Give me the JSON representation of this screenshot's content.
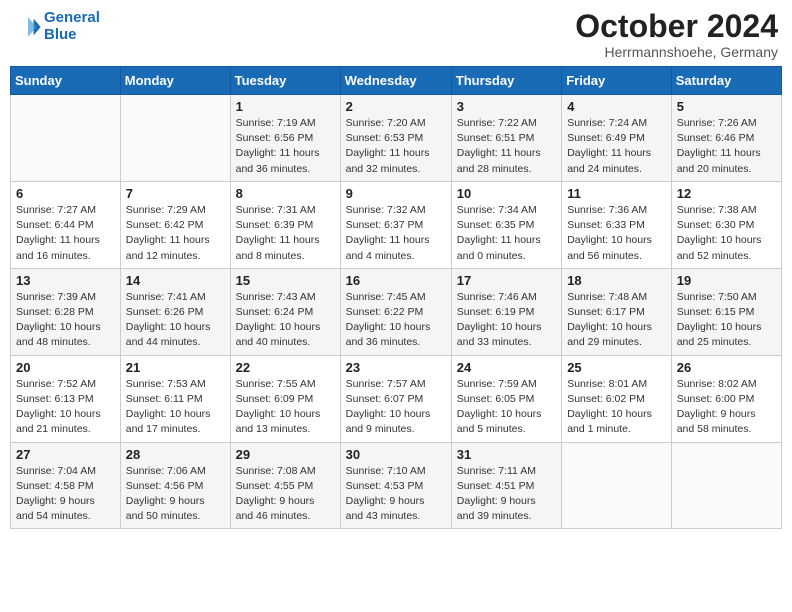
{
  "logo": {
    "line1": "General",
    "line2": "Blue"
  },
  "title": "October 2024",
  "location": "Herrmannshoehe, Germany",
  "weekdays": [
    "Sunday",
    "Monday",
    "Tuesday",
    "Wednesday",
    "Thursday",
    "Friday",
    "Saturday"
  ],
  "weeks": [
    [
      {
        "day": "",
        "info": ""
      },
      {
        "day": "",
        "info": ""
      },
      {
        "day": "1",
        "info": "Sunrise: 7:19 AM\nSunset: 6:56 PM\nDaylight: 11 hours\nand 36 minutes."
      },
      {
        "day": "2",
        "info": "Sunrise: 7:20 AM\nSunset: 6:53 PM\nDaylight: 11 hours\nand 32 minutes."
      },
      {
        "day": "3",
        "info": "Sunrise: 7:22 AM\nSunset: 6:51 PM\nDaylight: 11 hours\nand 28 minutes."
      },
      {
        "day": "4",
        "info": "Sunrise: 7:24 AM\nSunset: 6:49 PM\nDaylight: 11 hours\nand 24 minutes."
      },
      {
        "day": "5",
        "info": "Sunrise: 7:26 AM\nSunset: 6:46 PM\nDaylight: 11 hours\nand 20 minutes."
      }
    ],
    [
      {
        "day": "6",
        "info": "Sunrise: 7:27 AM\nSunset: 6:44 PM\nDaylight: 11 hours\nand 16 minutes."
      },
      {
        "day": "7",
        "info": "Sunrise: 7:29 AM\nSunset: 6:42 PM\nDaylight: 11 hours\nand 12 minutes."
      },
      {
        "day": "8",
        "info": "Sunrise: 7:31 AM\nSunset: 6:39 PM\nDaylight: 11 hours\nand 8 minutes."
      },
      {
        "day": "9",
        "info": "Sunrise: 7:32 AM\nSunset: 6:37 PM\nDaylight: 11 hours\nand 4 minutes."
      },
      {
        "day": "10",
        "info": "Sunrise: 7:34 AM\nSunset: 6:35 PM\nDaylight: 11 hours\nand 0 minutes."
      },
      {
        "day": "11",
        "info": "Sunrise: 7:36 AM\nSunset: 6:33 PM\nDaylight: 10 hours\nand 56 minutes."
      },
      {
        "day": "12",
        "info": "Sunrise: 7:38 AM\nSunset: 6:30 PM\nDaylight: 10 hours\nand 52 minutes."
      }
    ],
    [
      {
        "day": "13",
        "info": "Sunrise: 7:39 AM\nSunset: 6:28 PM\nDaylight: 10 hours\nand 48 minutes."
      },
      {
        "day": "14",
        "info": "Sunrise: 7:41 AM\nSunset: 6:26 PM\nDaylight: 10 hours\nand 44 minutes."
      },
      {
        "day": "15",
        "info": "Sunrise: 7:43 AM\nSunset: 6:24 PM\nDaylight: 10 hours\nand 40 minutes."
      },
      {
        "day": "16",
        "info": "Sunrise: 7:45 AM\nSunset: 6:22 PM\nDaylight: 10 hours\nand 36 minutes."
      },
      {
        "day": "17",
        "info": "Sunrise: 7:46 AM\nSunset: 6:19 PM\nDaylight: 10 hours\nand 33 minutes."
      },
      {
        "day": "18",
        "info": "Sunrise: 7:48 AM\nSunset: 6:17 PM\nDaylight: 10 hours\nand 29 minutes."
      },
      {
        "day": "19",
        "info": "Sunrise: 7:50 AM\nSunset: 6:15 PM\nDaylight: 10 hours\nand 25 minutes."
      }
    ],
    [
      {
        "day": "20",
        "info": "Sunrise: 7:52 AM\nSunset: 6:13 PM\nDaylight: 10 hours\nand 21 minutes."
      },
      {
        "day": "21",
        "info": "Sunrise: 7:53 AM\nSunset: 6:11 PM\nDaylight: 10 hours\nand 17 minutes."
      },
      {
        "day": "22",
        "info": "Sunrise: 7:55 AM\nSunset: 6:09 PM\nDaylight: 10 hours\nand 13 minutes."
      },
      {
        "day": "23",
        "info": "Sunrise: 7:57 AM\nSunset: 6:07 PM\nDaylight: 10 hours\nand 9 minutes."
      },
      {
        "day": "24",
        "info": "Sunrise: 7:59 AM\nSunset: 6:05 PM\nDaylight: 10 hours\nand 5 minutes."
      },
      {
        "day": "25",
        "info": "Sunrise: 8:01 AM\nSunset: 6:02 PM\nDaylight: 10 hours\nand 1 minute."
      },
      {
        "day": "26",
        "info": "Sunrise: 8:02 AM\nSunset: 6:00 PM\nDaylight: 9 hours\nand 58 minutes."
      }
    ],
    [
      {
        "day": "27",
        "info": "Sunrise: 7:04 AM\nSunset: 4:58 PM\nDaylight: 9 hours\nand 54 minutes."
      },
      {
        "day": "28",
        "info": "Sunrise: 7:06 AM\nSunset: 4:56 PM\nDaylight: 9 hours\nand 50 minutes."
      },
      {
        "day": "29",
        "info": "Sunrise: 7:08 AM\nSunset: 4:55 PM\nDaylight: 9 hours\nand 46 minutes."
      },
      {
        "day": "30",
        "info": "Sunrise: 7:10 AM\nSunset: 4:53 PM\nDaylight: 9 hours\nand 43 minutes."
      },
      {
        "day": "31",
        "info": "Sunrise: 7:11 AM\nSunset: 4:51 PM\nDaylight: 9 hours\nand 39 minutes."
      },
      {
        "day": "",
        "info": ""
      },
      {
        "day": "",
        "info": ""
      }
    ]
  ]
}
